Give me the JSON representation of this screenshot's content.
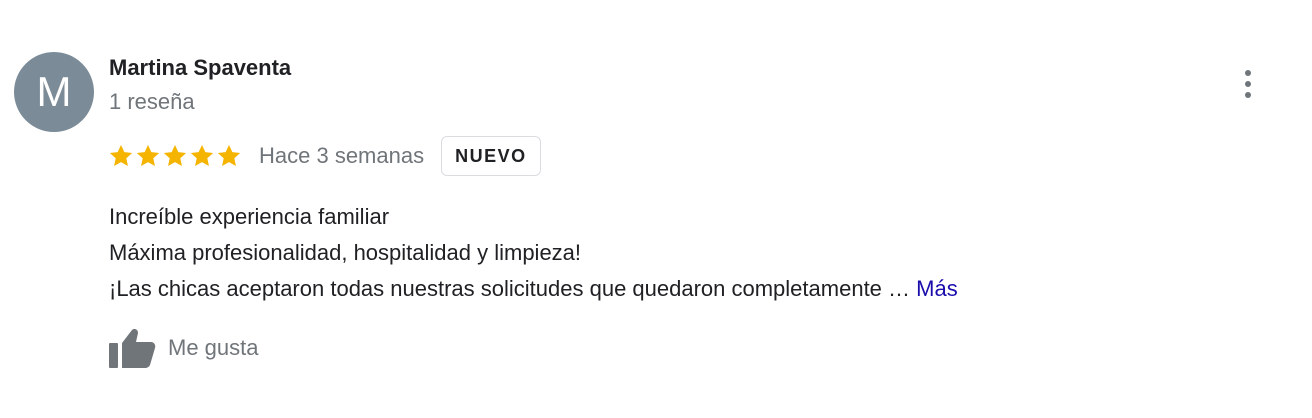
{
  "review": {
    "avatar_initial": "M",
    "author_name": "Martina Spaventa",
    "review_count": "1 reseña",
    "rating": 5,
    "rating_max": 5,
    "time_ago": "Hace 3 semanas",
    "badge": "NUEVO",
    "text_lines": [
      "Increíble experiencia familiar",
      "Máxima profesionalidad, hospitalidad y limpieza!",
      "¡Las chicas aceptaron todas nuestras solicitudes que quedaron completamente …"
    ],
    "more_label": "Más",
    "like_label": "Me gusta"
  },
  "icons": {
    "menu": "more-vert-icon",
    "like": "thumbs-up-icon",
    "star": "star-icon"
  },
  "colors": {
    "avatar_bg": "#7b8b97",
    "star": "#f4b400",
    "link": "#1a0dab",
    "muted_text": "#70757a",
    "text": "#202124"
  }
}
